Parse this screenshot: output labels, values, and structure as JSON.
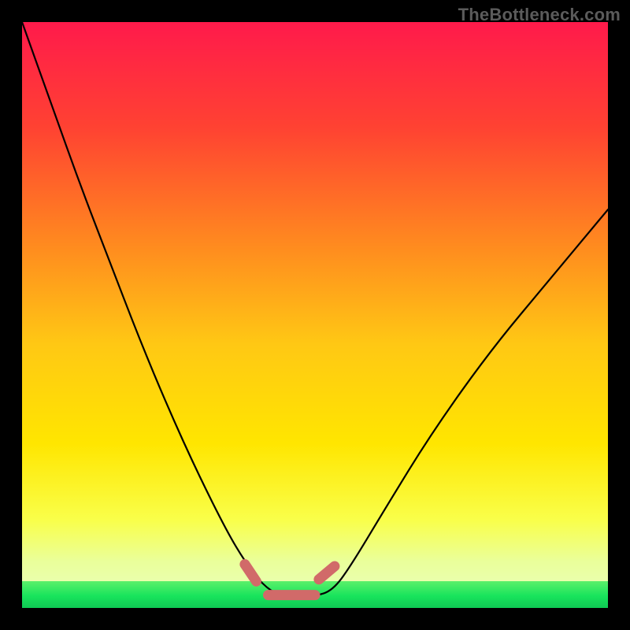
{
  "watermark": "TheBottleneck.com",
  "colors": {
    "frame": "#000000",
    "curve": "#000000",
    "marker": "#d16a69",
    "green_band": "#18e45c",
    "gradient_top": "#ff1a4b",
    "gradient_mid1": "#ff7a2a",
    "gradient_mid2": "#ffe600",
    "gradient_low": "#f6ff7a"
  },
  "chart_data": {
    "type": "line",
    "title": "",
    "xlabel": "",
    "ylabel": "",
    "x": [
      0.0,
      0.05,
      0.1,
      0.15,
      0.2,
      0.25,
      0.3,
      0.35,
      0.38,
      0.41,
      0.44,
      0.47,
      0.5,
      0.53,
      0.56,
      0.62,
      0.7,
      0.8,
      0.9,
      1.0
    ],
    "values": [
      1.0,
      0.86,
      0.72,
      0.59,
      0.46,
      0.34,
      0.23,
      0.13,
      0.08,
      0.04,
      0.02,
      0.02,
      0.02,
      0.03,
      0.07,
      0.17,
      0.3,
      0.44,
      0.56,
      0.68
    ],
    "ylim": [
      0,
      1
    ],
    "xlim": [
      0,
      1
    ],
    "marker_points": [
      {
        "x": 0.39,
        "y": 0.06
      },
      {
        "x": 0.52,
        "y": 0.06
      }
    ],
    "flat_min_range": {
      "x0": 0.42,
      "x1": 0.5,
      "y": 0.022
    }
  }
}
